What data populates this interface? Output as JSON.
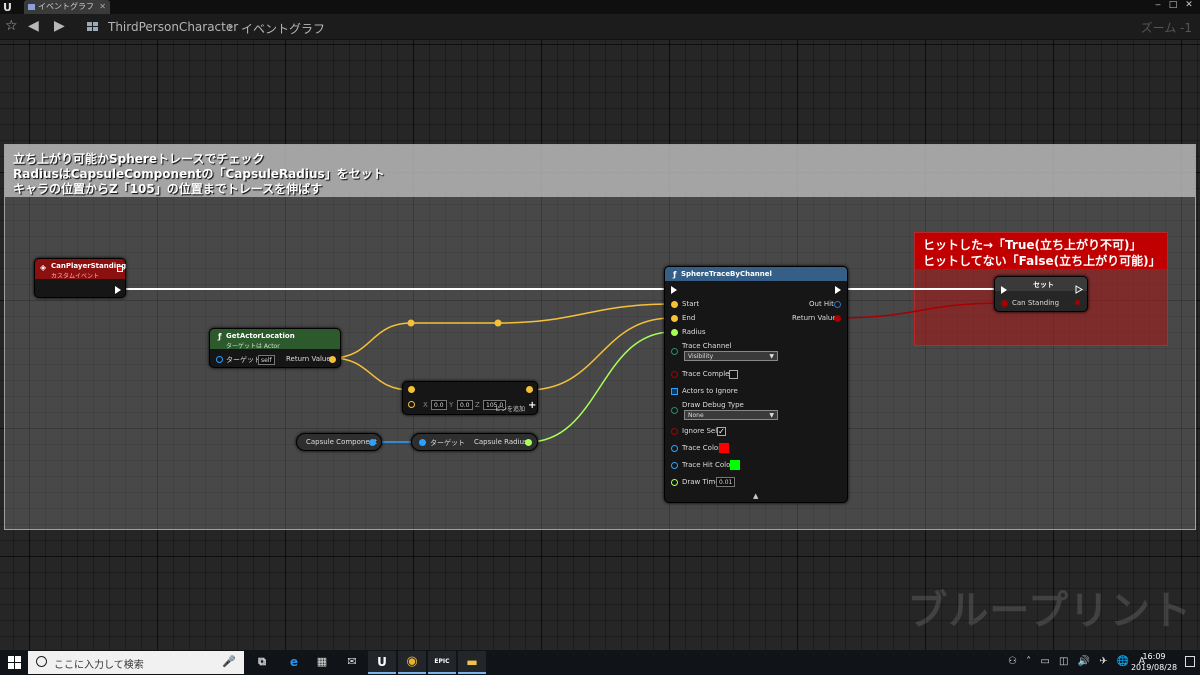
{
  "window": {
    "tab_title": "イベントグラフ",
    "controls": [
      "‒",
      "□",
      "✕"
    ]
  },
  "toolbar": {
    "breadcrumb": [
      "ThirdPersonCharacter",
      "イベントグラフ"
    ],
    "separator": "›",
    "zoom": "ズーム -1"
  },
  "graph": {
    "watermark": "ブループリント",
    "main_comment": {
      "lines": [
        "立ち上がり可能かSphereトレースでチェック",
        "RadiusはCapsuleComponentの「CapsuleRadius」をセット",
        "キャラの位置からZ「105」の位置までトレースを伸ばす"
      ]
    },
    "red_comment": {
      "lines": [
        "ヒットした→「True(立ち上がり不可)」",
        "ヒットしてない「False(立ち上がり可能)」"
      ],
      "color": "#c00000"
    },
    "nodes": {
      "event": {
        "title": "CanPlayerStanding",
        "subtitle": "カスタムイベント",
        "header_color": "#8b1010"
      },
      "get_actor_location": {
        "title": "GetActorLocation",
        "subtitle": "ターゲットは Actor",
        "target_label": "ターゲット",
        "target_value": "self",
        "return_label": "Return Value",
        "header_color": "#2d5a2d"
      },
      "add_vector": {
        "x_label": "X",
        "x_value": "0.0",
        "y_label": "Y",
        "y_value": "0.0",
        "z_label": "Z",
        "z_value": "105.0",
        "add_pin_label": "ピンを追加"
      },
      "capsule_component": {
        "label": "Capsule Component"
      },
      "get_capsule_radius": {
        "target_label": "ターゲット",
        "output_label": "Capsule Radius"
      },
      "sphere_trace": {
        "title": "SphereTraceByChannel",
        "header_color": "#355f86",
        "pins_left": [
          "Start",
          "End",
          "Radius"
        ],
        "pins_right": [
          "Out Hit",
          "Return Value"
        ],
        "trace_channel_label": "Trace Channel",
        "trace_channel_value": "Visibility",
        "trace_complex_label": "Trace Complex",
        "actors_to_ignore_label": "Actors to Ignore",
        "draw_debug_type_label": "Draw Debug Type",
        "draw_debug_type_value": "None",
        "ignore_self_label": "Ignore Self",
        "ignore_self_checked": true,
        "trace_color_label": "Trace Color",
        "trace_color": "#ff0000",
        "trace_hit_color_label": "Trace Hit Color",
        "trace_hit_color": "#00ff00",
        "draw_time_label": "Draw Time",
        "draw_time_value": "0.01"
      },
      "set_node": {
        "title": "セット",
        "pin_label": "Can Standing",
        "header_color": "#3a3a3a"
      }
    },
    "pin_colors": {
      "exec": "#ffffff",
      "vector": "#f5c13a",
      "float": "#a8ff5a",
      "object": "#2ca0ff",
      "bool": "#a80000",
      "struct": "#3070c0"
    }
  },
  "taskbar": {
    "search_placeholder": "ここに入力して検索",
    "clock_time": "16:09",
    "clock_date": "2019/08/28",
    "epic_label": "EPIC"
  }
}
